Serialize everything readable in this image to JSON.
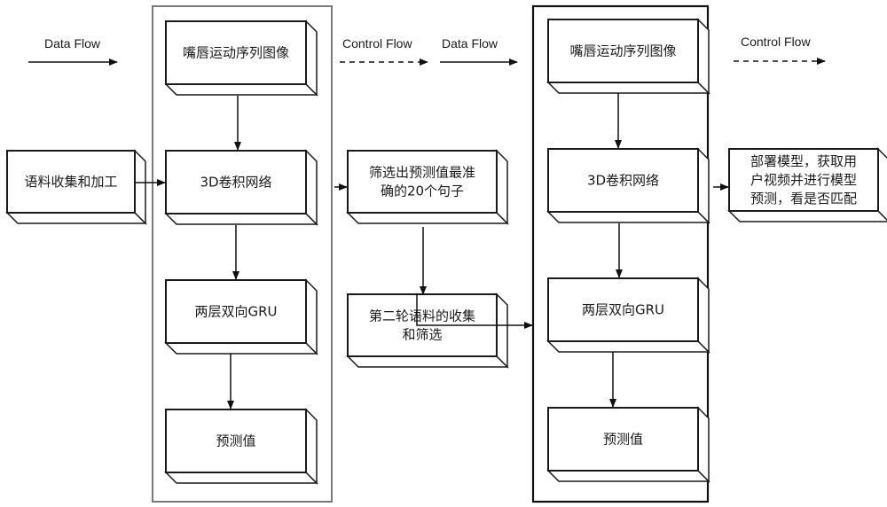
{
  "legends": [
    {
      "id": "legend-data-flow-1",
      "label": "Data Flow",
      "style": "solid"
    },
    {
      "id": "legend-control-flow-1",
      "label": "Control Flow",
      "style": "dashed"
    },
    {
      "id": "legend-data-flow-2",
      "label": "Data Flow",
      "style": "solid"
    },
    {
      "id": "legend-control-flow-2",
      "label": "Control Flow",
      "style": "dashed"
    }
  ],
  "containers": [
    {
      "id": "stage-1-container",
      "border_color": "#7a7a7a"
    },
    {
      "id": "stage-2-container",
      "border_color": "#111111"
    }
  ],
  "nodes": {
    "corpus_collection": {
      "lines": [
        "语料收集和加工"
      ]
    },
    "s1_lip_images": {
      "lines": [
        "嘴唇运动序列图像"
      ]
    },
    "s1_3d_cnn": {
      "lines": [
        "3D卷积网络"
      ]
    },
    "s1_bigru": {
      "lines": [
        "两层双向GRU"
      ]
    },
    "s1_prediction": {
      "lines": [
        "预测值"
      ]
    },
    "select_top20": {
      "lines": [
        "筛选出预测值最准",
        "确的20个句子"
      ]
    },
    "second_round": {
      "lines": [
        "第二轮语料的收集",
        "和筛选"
      ]
    },
    "s2_lip_images": {
      "lines": [
        "嘴唇运动序列图像"
      ]
    },
    "s2_3d_cnn": {
      "lines": [
        "3D卷积网络"
      ]
    },
    "s2_bigru": {
      "lines": [
        "两层双向GRU"
      ]
    },
    "s2_prediction": {
      "lines": [
        "预测值"
      ]
    },
    "deploy": {
      "lines": [
        "部署模型，获取用",
        "户视频并进行模型",
        "预测，看是否匹配"
      ]
    }
  },
  "edges": [
    {
      "from": "corpus_collection",
      "to": "s1_3d_cnn",
      "style": "solid"
    },
    {
      "from": "s1_lip_images",
      "to": "s1_3d_cnn",
      "style": "solid"
    },
    {
      "from": "s1_3d_cnn",
      "to": "s1_bigru",
      "style": "solid"
    },
    {
      "from": "s1_bigru",
      "to": "s1_prediction",
      "style": "solid"
    },
    {
      "from": "stage-1-container",
      "to": "select_top20",
      "style": "solid"
    },
    {
      "from": "select_top20",
      "to": "second_round",
      "style": "solid"
    },
    {
      "from": "second_round",
      "to": "stage-2-container",
      "style": "solid"
    },
    {
      "from": "s2_lip_images",
      "to": "s2_3d_cnn",
      "style": "solid"
    },
    {
      "from": "s2_3d_cnn",
      "to": "s2_bigru",
      "style": "solid"
    },
    {
      "from": "s2_bigru",
      "to": "s2_prediction",
      "style": "solid"
    },
    {
      "from": "stage-2-container",
      "to": "deploy",
      "style": "solid"
    }
  ]
}
